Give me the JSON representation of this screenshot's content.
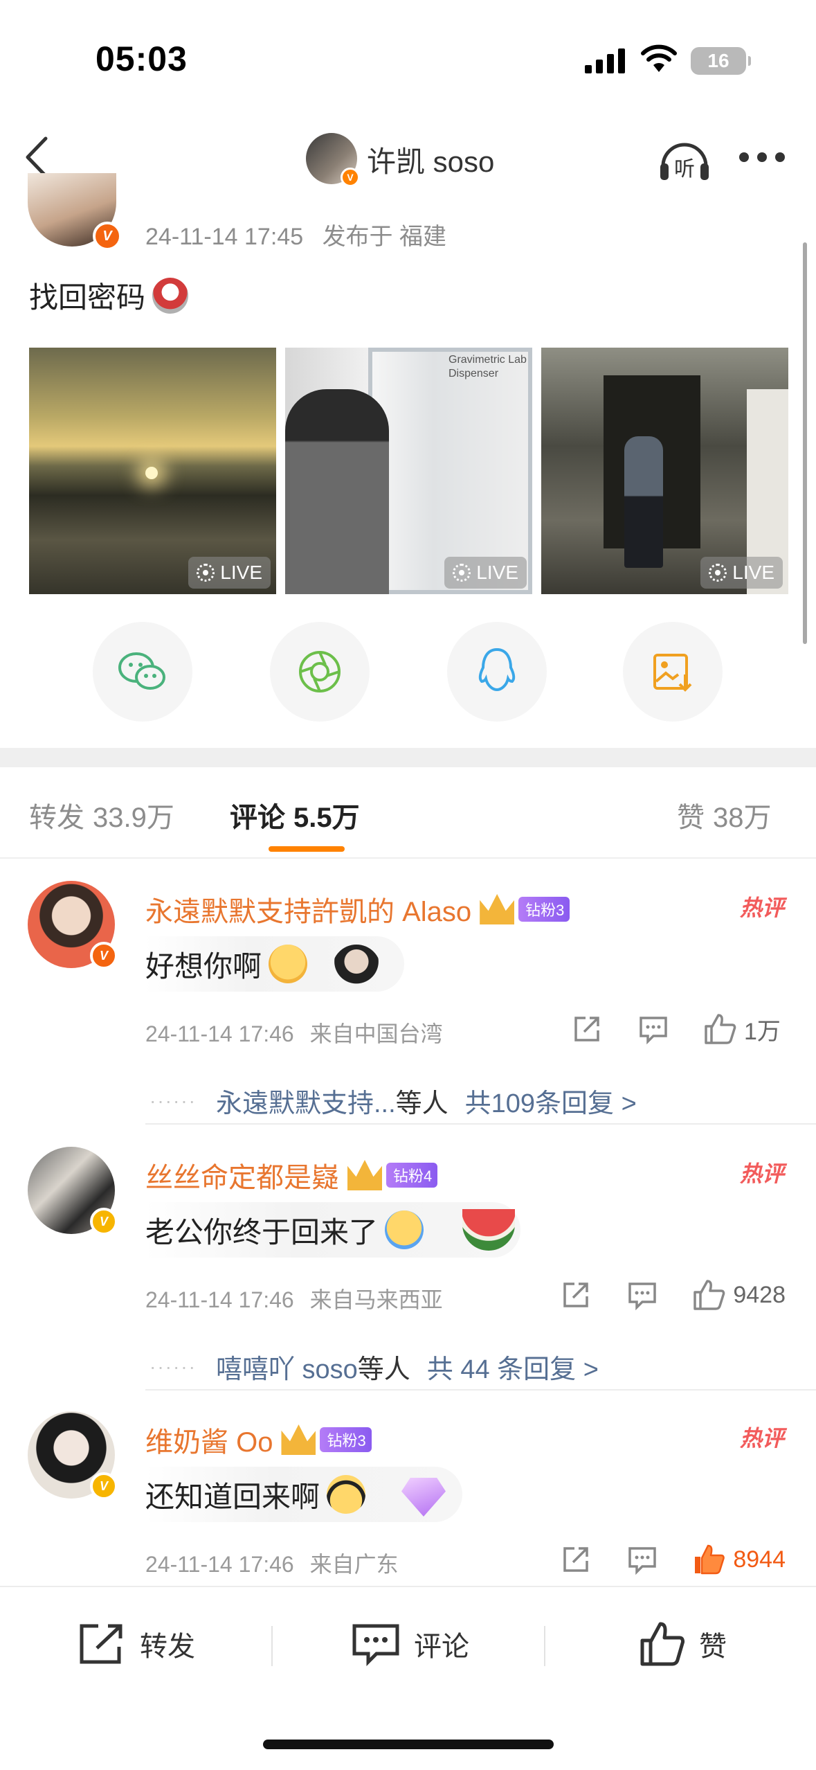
{
  "status_bar": {
    "time": "05:03",
    "battery": "16"
  },
  "nav": {
    "title": "许凯 soso",
    "listen_icon_label": "听"
  },
  "post": {
    "timestamp": "24-11-14 17:45",
    "location": "发布于 福建",
    "text": "找回密码",
    "photos": [
      {
        "badge": "LIVE",
        "overlay_text": ""
      },
      {
        "badge": "LIVE",
        "overlay_text": "Gravimetric Lab Dispenser"
      },
      {
        "badge": "LIVE",
        "overlay_text": ""
      }
    ],
    "share_targets": [
      "wechat-icon",
      "moments-icon",
      "qq-icon",
      "save-image-icon"
    ]
  },
  "tabs": {
    "repost": {
      "label": "转发",
      "count": "33.9万"
    },
    "comment": {
      "label": "评论",
      "count": "5.5万"
    },
    "like": {
      "label": "赞",
      "count": "38万"
    }
  },
  "comments": [
    {
      "user": "永遠默默支持許凱的 Alaso",
      "fan_badge": "钻粉3",
      "hot_tag": "热评",
      "text": "好想你啊",
      "time": "24-11-14 17:46",
      "location": "来自中国台湾",
      "likes": "1万",
      "liked": false,
      "replies": {
        "users": "永遠默默支持...",
        "suffix": "等人",
        "total": "共109条回复 >"
      }
    },
    {
      "user": "丝丝命定都是嶷",
      "fan_badge": "钻粉4",
      "hot_tag": "热评",
      "text": "老公你终于回来了",
      "time": "24-11-14 17:46",
      "location": "来自马来西亚",
      "likes": "9428",
      "liked": false,
      "replies": {
        "users": "嘻嘻吖 soso",
        "suffix": "等人",
        "total": "共 44 条回复 >"
      }
    },
    {
      "user": "维奶酱 Oo",
      "fan_badge": "钻粉3",
      "hot_tag": "热评",
      "text": "还知道回来啊",
      "time": "24-11-14 17:46",
      "location": "来自广东",
      "likes": "8944",
      "liked": true
    }
  ],
  "bottom_bar": {
    "repost": "转发",
    "comment": "评论",
    "like": "赞"
  },
  "colors": {
    "accent": "#ff8200",
    "username": "#e8762f",
    "link": "#566f93",
    "hot": "#f25b5b"
  }
}
